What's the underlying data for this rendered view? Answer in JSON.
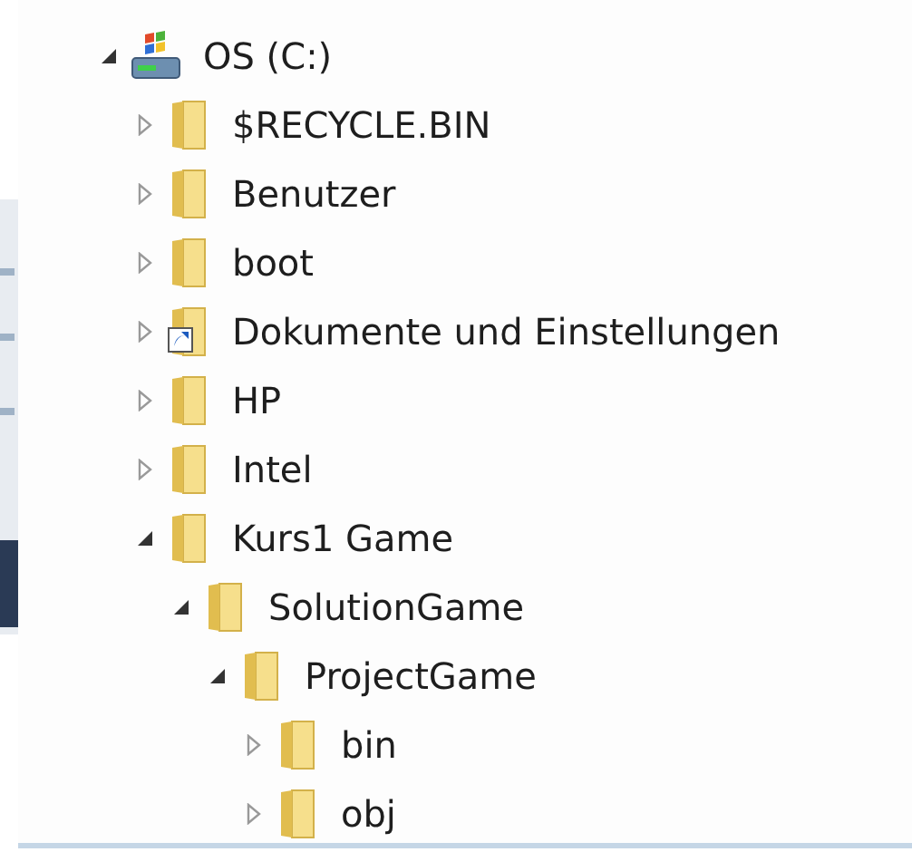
{
  "tree": [
    {
      "name": "OS (C:)",
      "kind": "drive",
      "expanded": true,
      "children": [
        {
          "name": "$RECYCLE.BIN",
          "kind": "folder",
          "expanded": false
        },
        {
          "name": "Benutzer",
          "kind": "folder",
          "expanded": false
        },
        {
          "name": "boot",
          "kind": "folder",
          "expanded": false
        },
        {
          "name": "Dokumente und Einstellungen",
          "kind": "shortcut",
          "expanded": false
        },
        {
          "name": "HP",
          "kind": "folder",
          "expanded": false
        },
        {
          "name": "Intel",
          "kind": "folder",
          "expanded": false
        },
        {
          "name": "Kurs1 Game",
          "kind": "folder",
          "expanded": true,
          "children": [
            {
              "name": "SolutionGame",
              "kind": "folder",
              "expanded": true,
              "children": [
                {
                  "name": "ProjectGame",
                  "kind": "folder",
                  "expanded": true,
                  "children": [
                    {
                      "name": "bin",
                      "kind": "folder",
                      "expanded": false
                    },
                    {
                      "name": "obj",
                      "kind": "folder",
                      "expanded": false
                    }
                  ]
                }
              ]
            }
          ]
        }
      ]
    }
  ]
}
